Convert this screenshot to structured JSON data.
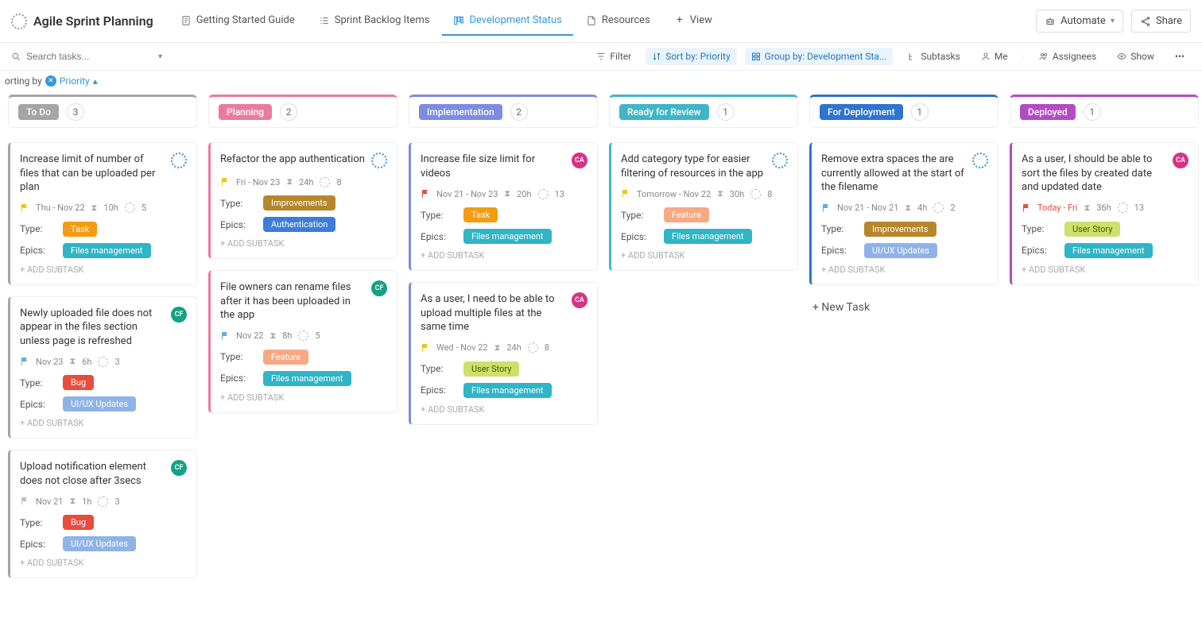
{
  "header": {
    "title": "Agile Sprint Planning",
    "tabs": [
      {
        "label": "Getting Started Guide"
      },
      {
        "label": "Sprint Backlog Items"
      },
      {
        "label": "Development Status",
        "active": true
      },
      {
        "label": "Resources"
      },
      {
        "label": "View",
        "isAdd": true
      }
    ],
    "automate": "Automate",
    "share": "Share"
  },
  "toolbar": {
    "search_placeholder": "Search tasks...",
    "filter": "Filter",
    "sort": "Sort by: Priority",
    "group": "Group by: Development Sta...",
    "subtasks": "Subtasks",
    "me": "Me",
    "assignees": "Assignees",
    "show": "Show"
  },
  "sortrow": {
    "prefix": "orting by",
    "value": "Priority"
  },
  "columns": [
    {
      "name": "To Do",
      "count": "3",
      "accent": "#a5a5a5",
      "cards": [
        {
          "title": "Increase limit of number of files that can be uploaded per plan",
          "avatar": "dotted",
          "flag": "#f1c40f",
          "date": "Thu  -  Nov 22",
          "estimate": "10h",
          "points": "5",
          "type": {
            "label": "Task",
            "cls": "task"
          },
          "epic": {
            "label": "Files management",
            "cls": "files"
          }
        },
        {
          "title": "Newly uploaded file does not appear in the files section unless page is refreshed",
          "avatar": "teal",
          "flag": "#5dade2",
          "date": "Nov 23",
          "estimate": "6h",
          "points": "3",
          "type": {
            "label": "Bug",
            "cls": "bug"
          },
          "epic": {
            "label": "UI/UX Updates",
            "cls": "uiux"
          }
        },
        {
          "title": "Upload notification element does not close after 3secs",
          "avatar": "teal",
          "flag": "#bdc3c7",
          "date": "Nov 21",
          "estimate": "1h",
          "points": "3",
          "type": {
            "label": "Bug",
            "cls": "bug"
          },
          "epic": {
            "label": "UI/UX Updates",
            "cls": "uiux"
          }
        }
      ]
    },
    {
      "name": "Planning",
      "count": "2",
      "accent": "#ea7aa1",
      "cards": [
        {
          "title": "Refactor the app authentication",
          "avatar": "dotted",
          "flag": "#f1c40f",
          "date": "Fri  -  Nov 23",
          "estimate": "24h",
          "points": "8",
          "type": {
            "label": "Improvements",
            "cls": "improvements"
          },
          "epic": {
            "label": "Authentication",
            "cls": "auth"
          }
        },
        {
          "title": "File owners can rename files after it has been uploaded in the app",
          "avatar": "teal",
          "flag": "#5dade2",
          "date": "Nov 22",
          "estimate": "8h",
          "points": "5",
          "type": {
            "label": "Feature",
            "cls": "feature"
          },
          "epic": {
            "label": "Files management",
            "cls": "files"
          }
        }
      ]
    },
    {
      "name": "Implementation",
      "count": "2",
      "accent": "#7e8ce0",
      "cards": [
        {
          "title": "Increase file size limit for videos",
          "avatar": "pink",
          "flag": "#e74c3c",
          "date": "Nov 21  -  Nov 23",
          "estimate": "20h",
          "points": "13",
          "type": {
            "label": "Task",
            "cls": "task"
          },
          "epic": {
            "label": "Files management",
            "cls": "files"
          }
        },
        {
          "title": "As a user, I need to be able to upload multiple files at the same time",
          "avatar": "pink",
          "flag": "#f1c40f",
          "date": "Wed  -  Nov 22",
          "estimate": "24h",
          "points": "8",
          "type": {
            "label": "User Story",
            "cls": "userstory"
          },
          "epic": {
            "label": "Files management",
            "cls": "files"
          }
        }
      ]
    },
    {
      "name": "Ready for Review",
      "count": "1",
      "accent": "#3fb6c8",
      "cards": [
        {
          "title": "Add category type for easier filtering of resources in the app",
          "avatar": "dotted",
          "flag": "#f1c40f",
          "date": "Tomorrow  -  Nov 22",
          "estimate": "30h",
          "points": "8",
          "type": {
            "label": "Feature",
            "cls": "feature"
          },
          "epic": {
            "label": "Files management",
            "cls": "files"
          }
        }
      ]
    },
    {
      "name": "For Deployment",
      "count": "1",
      "accent": "#2f74d0",
      "extra": "new-task",
      "cards": [
        {
          "title": "Remove extra spaces the are currently allowed at the start of the filename",
          "avatar": "dotted",
          "flag": "#5dade2",
          "date": "Nov 21  -  Nov 21",
          "estimate": "4h",
          "points": "2",
          "type": {
            "label": "Improvements",
            "cls": "improvements"
          },
          "epic": {
            "label": "UI/UX Updates",
            "cls": "uiux"
          }
        }
      ]
    },
    {
      "name": "Deployed",
      "count": "1",
      "accent": "#b34bc4",
      "cards": [
        {
          "title": "As a user, I should be able to sort the files by created date and updated date",
          "avatar": "pink",
          "flag": "#e74c3c",
          "date": "Today  -  Fri",
          "dateColor": "#e74c3c",
          "estimate": "36h",
          "points": "13",
          "type": {
            "label": "User Story",
            "cls": "userstory"
          },
          "epic": {
            "label": "Files management",
            "cls": "files"
          }
        }
      ]
    }
  ],
  "labels": {
    "type": "Type:",
    "epics": "Epics:",
    "add_subtask": "+ ADD SUBTASK",
    "new_task": "+ New Task"
  }
}
